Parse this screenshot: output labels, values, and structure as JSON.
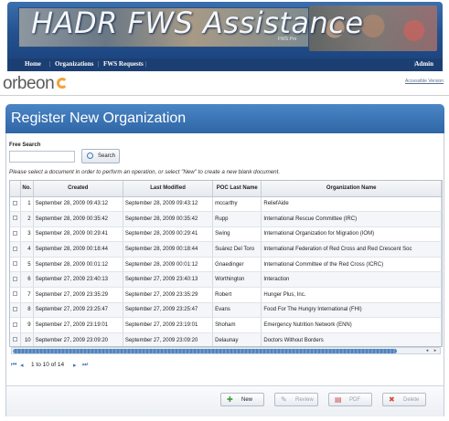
{
  "header": {
    "title": "HADR FWS Assistance",
    "subtitle": "FWS Pro",
    "nav": [
      "Home",
      "Organizations",
      "FWS Requests"
    ],
    "admin_label": "Admin"
  },
  "orbeon": {
    "logo": "orbeon",
    "accessible_link": "Accessible Version"
  },
  "page": {
    "title": "Register New Organization",
    "free_search_label": "Free Search",
    "search_value": "",
    "search_button": "Search",
    "instructions": "Please select a document in order to perform an operation, or select \"New\" to create a new blank document."
  },
  "table": {
    "columns": [
      "",
      "No.",
      "Created",
      "Last Modified",
      "POC Last Name",
      "Organization Name"
    ],
    "rows": [
      [
        "1",
        "September 28, 2009 09:43:12",
        "September 28, 2009 09:43:12",
        "mccarthy",
        "ReliefAide"
      ],
      [
        "2",
        "September 28, 2009 00:35:42",
        "September 28, 2009 00:35:42",
        "Rupp",
        "International Rescue Committee (IRC)"
      ],
      [
        "3",
        "September 28, 2009 00:29:41",
        "September 28, 2009 00:29:41",
        "Swing",
        "International Organization for Migration (IOM)"
      ],
      [
        "4",
        "September 28, 2009 00:18:44",
        "September 28, 2009 00:18:44",
        "Suárez Del Toro",
        "International Federation of Red Cross and Red Crescent Soc"
      ],
      [
        "5",
        "September 28, 2009 00:01:12",
        "September 28, 2009 00:01:12",
        "Gnaedinger",
        "International Committee of the Red Cross (ICRC)"
      ],
      [
        "6",
        "September 27, 2009 23:40:13",
        "September 27, 2009 23:40:13",
        "Worthington",
        "Interaction"
      ],
      [
        "7",
        "September 27, 2009 23:35:29",
        "September 27, 2009 23:35:29",
        "Robert",
        "Hunger Plus, Inc."
      ],
      [
        "8",
        "September 27, 2009 23:25:47",
        "September 27, 2009 23:25:47",
        "Evans",
        "Food For The Hungry International (FHI)"
      ],
      [
        "9",
        "September 27, 2009 23:19:01",
        "September 27, 2009 23:19:01",
        "Shoham",
        "Emergency Nutrition Network (ENN)"
      ],
      [
        "10",
        "September 27, 2009 23:09:20",
        "September 27, 2009 23:09:20",
        "Delaunay",
        "Doctors Without Borders"
      ]
    ]
  },
  "pager": {
    "text": "1 to 10 of 14"
  },
  "actions": {
    "new": "New",
    "review": "Review",
    "pdf": "PDF",
    "delete": "Delete"
  },
  "colors": {
    "banner": "#24518f",
    "title_bar": "#3a76b8",
    "logo_accent": "#f2a23a"
  }
}
